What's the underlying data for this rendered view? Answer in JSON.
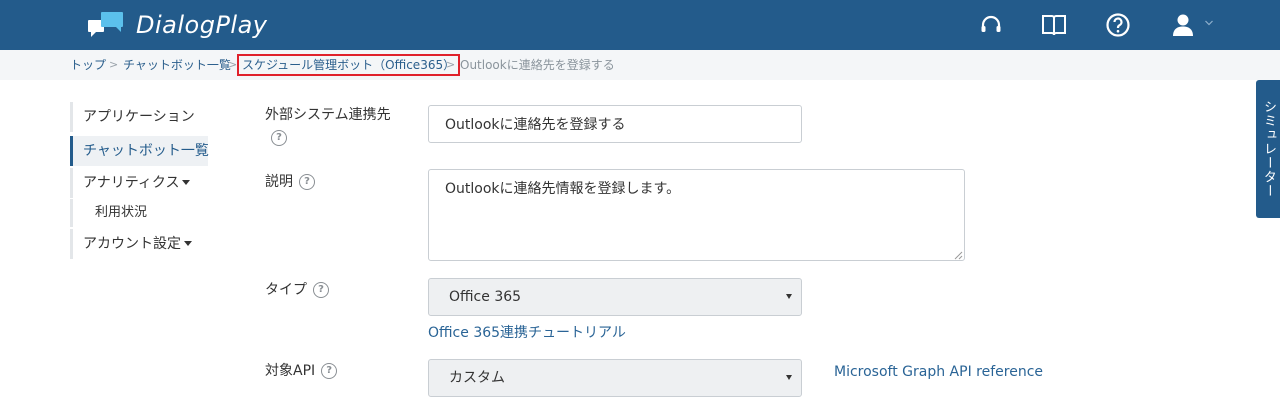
{
  "header": {
    "brand": "DialogPlay",
    "icons": [
      "headset-icon",
      "book-icon",
      "help-icon",
      "user-icon"
    ]
  },
  "breadcrumb": {
    "items": [
      "トップ",
      "チャットボット一覧",
      "スケジュール管理ボット（Office365）",
      "Outlookに連絡先を登録する"
    ],
    "separator": ">"
  },
  "sidebar": {
    "items": [
      {
        "label": "アプリケーション"
      },
      {
        "label": "チャットボット一覧"
      },
      {
        "label": "アナリティクス"
      },
      {
        "label": "利用状況"
      },
      {
        "label": "アカウント設定"
      }
    ]
  },
  "form": {
    "system": {
      "label": "外部システム連携先",
      "value": "Outlookに連絡先を登録する"
    },
    "description": {
      "label": "説明",
      "value": "Outlookに連絡先情報を登録します。"
    },
    "type": {
      "label": "タイプ",
      "selected": "Office 365",
      "tutorial_link": "Office 365連携チュートリアル"
    },
    "api": {
      "label": "対象API",
      "selected": "カスタム",
      "reference_link": "Microsoft Graph API reference"
    }
  },
  "simulator": {
    "label": "シミュレーター"
  },
  "colors": {
    "header": "#235b8b",
    "link": "#2a6496",
    "highlight_border": "#e0212b"
  }
}
